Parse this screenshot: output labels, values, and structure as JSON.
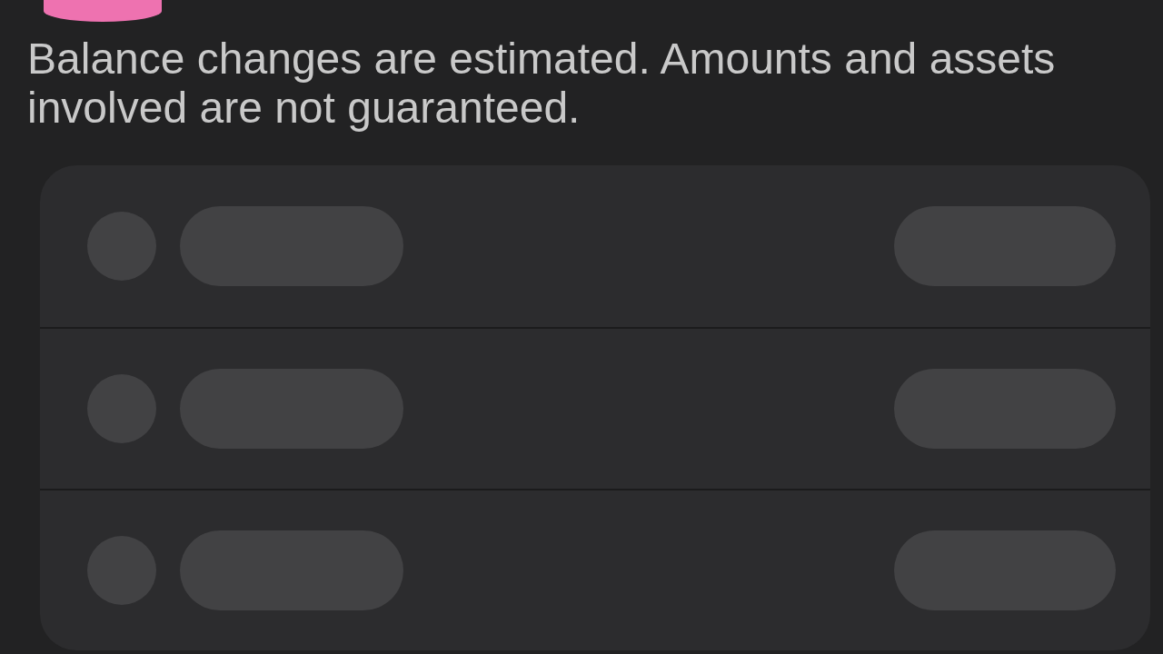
{
  "disclaimer": "Balance changes are estimated. Amounts and assets involved are not guaranteed.",
  "balance_changes": {
    "rows": [
      {
        "loading": true
      },
      {
        "loading": true
      },
      {
        "loading": true
      }
    ]
  }
}
